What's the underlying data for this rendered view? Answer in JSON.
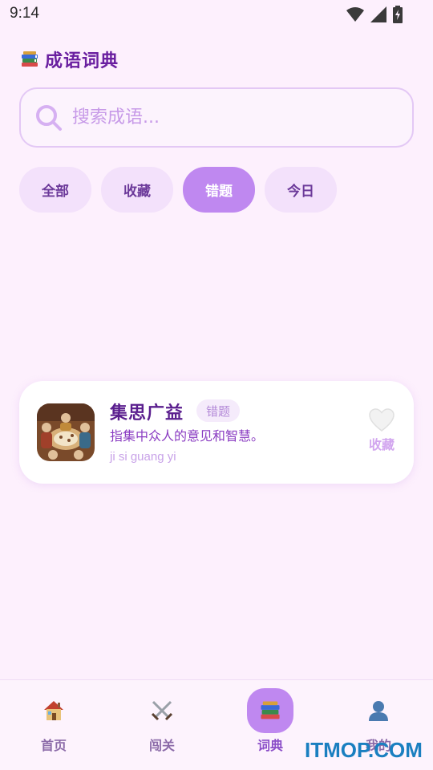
{
  "status_bar": {
    "time": "9:14"
  },
  "header": {
    "title": "成语词典",
    "icon": "books-icon"
  },
  "search": {
    "placeholder": "搜索成语..."
  },
  "tabs": [
    {
      "label": "全部",
      "active": false
    },
    {
      "label": "收藏",
      "active": false
    },
    {
      "label": "错题",
      "active": true
    },
    {
      "label": "今日",
      "active": false
    }
  ],
  "card": {
    "title": "集思广益",
    "badge": "错题",
    "description": "指集中众人的意见和智慧。",
    "pinyin": "ji si guang yi",
    "favorite_label": "收藏",
    "favorite_icon": "heart-outline-icon"
  },
  "bottom_nav": [
    {
      "label": "首页",
      "icon": "house-icon",
      "active": false
    },
    {
      "label": "闯关",
      "icon": "crossed-swords-icon",
      "active": false
    },
    {
      "label": "词典",
      "icon": "books-icon",
      "active": true
    },
    {
      "label": "我的",
      "icon": "user-icon",
      "active": false
    }
  ],
  "watermark": "ITMOP.COM",
  "colors": {
    "background": "#fdf0fd",
    "accent": "#bf88f0",
    "title": "#6a1fa0",
    "tab_bg": "#f3e1fb"
  }
}
